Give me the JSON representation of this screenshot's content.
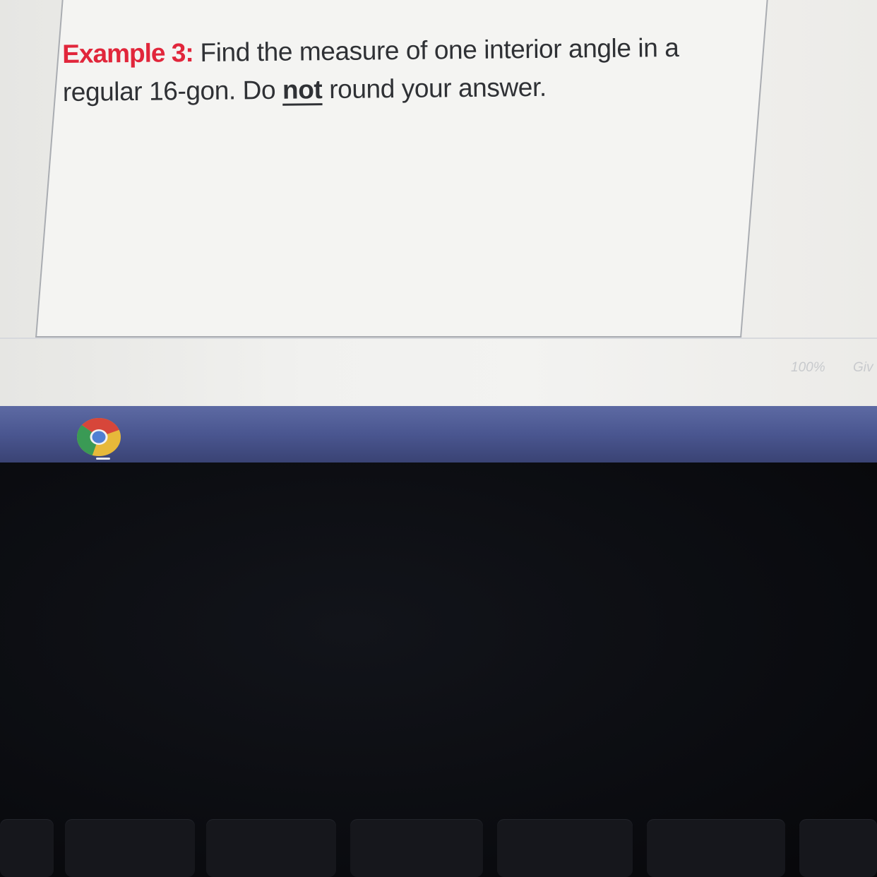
{
  "document": {
    "example_label": "Example 3:",
    "text_line_1": " Find the measure of one interior angle in a",
    "text_line_2_start": "regular 16-gon.  Do ",
    "emphasis_word": "not",
    "text_line_2_end": " round your answer."
  },
  "status_bar": {
    "zoom": "100%",
    "partial_text": "Giv"
  },
  "shelf": {
    "apps": [
      {
        "name": "Chrome",
        "icon": "chrome-icon",
        "running": true
      }
    ]
  },
  "colors": {
    "label_red": "#e1263b",
    "text_dark": "#2f3135",
    "shelf_blue": "#4a5690"
  }
}
